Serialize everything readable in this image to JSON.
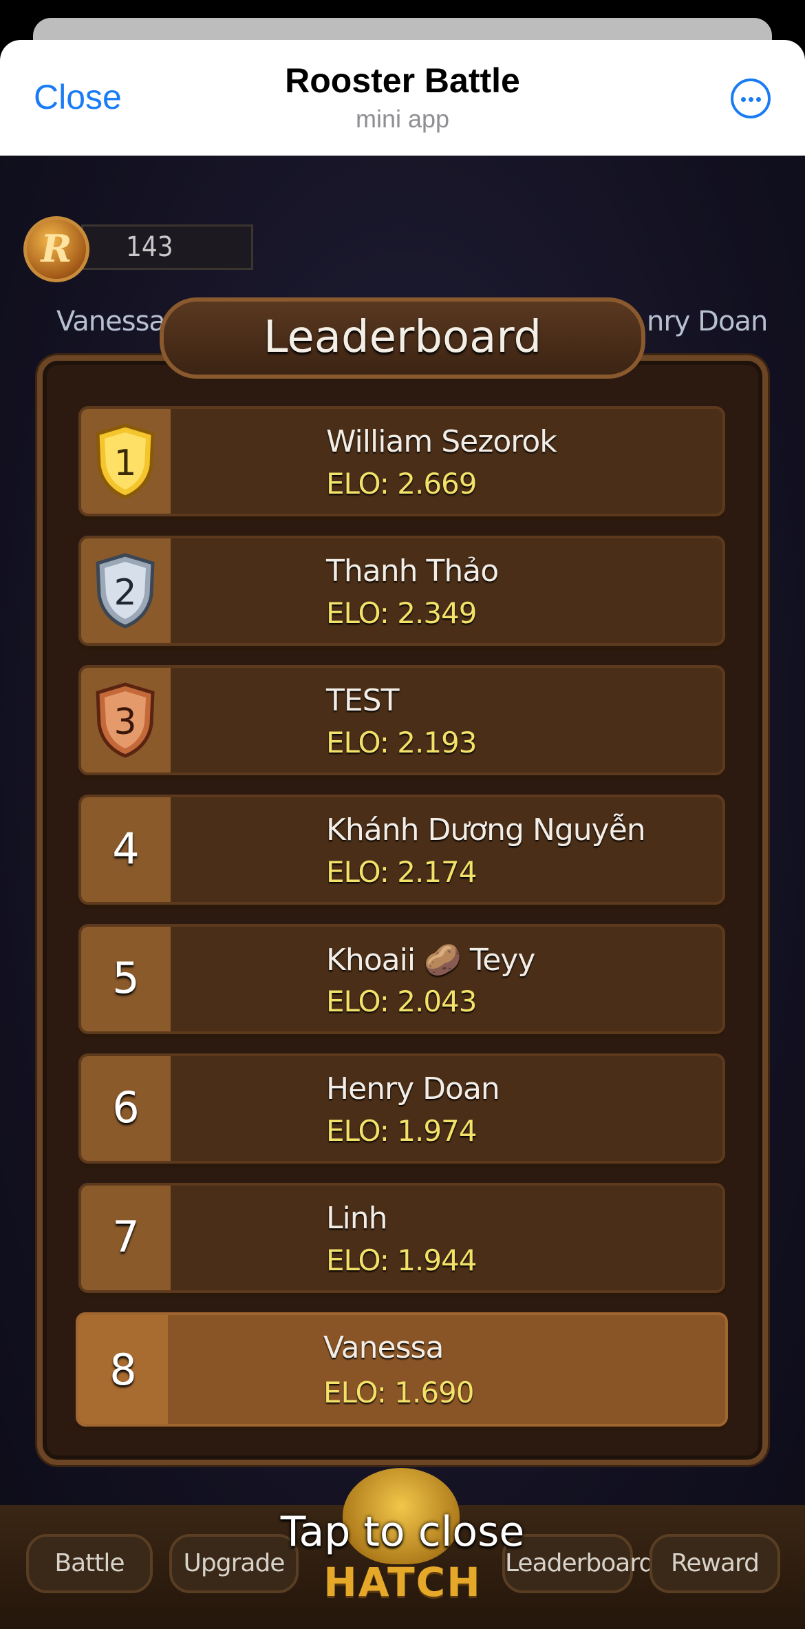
{
  "header": {
    "close_label": "Close",
    "title": "Rooster Battle",
    "subtitle": "mini app"
  },
  "game": {
    "coin_letter": "R",
    "coin_balance": "143",
    "left_player": "Vanessa",
    "right_player": "nry Doan"
  },
  "leaderboard": {
    "title": "Leaderboard",
    "rows": [
      {
        "rank": "1",
        "name": "William Sezorok",
        "elo": "ELO: 2.669",
        "badge": "gold-shield-icon"
      },
      {
        "rank": "2",
        "name": "Thanh Thảo",
        "elo": "ELO: 2.349",
        "badge": "silver-shield-icon"
      },
      {
        "rank": "3",
        "name": "TEST",
        "elo": "ELO: 2.193",
        "badge": "bronze-shield-icon"
      },
      {
        "rank": "4",
        "name": "Khánh Dương Nguyễn",
        "elo": "ELO: 2.174"
      },
      {
        "rank": "5",
        "name": "Khoaii 🥔 Teyy",
        "elo": "ELO: 2.043"
      },
      {
        "rank": "6",
        "name": "Henry Doan",
        "elo": "ELO: 1.974"
      },
      {
        "rank": "7",
        "name": "Linh",
        "elo": "ELO: 1.944"
      },
      {
        "rank": "8",
        "name": "Vanessa",
        "elo": "ELO: 1.690"
      }
    ]
  },
  "overlay": {
    "tap_to_close": "Tap to close"
  },
  "nav": {
    "battle": "Battle",
    "upgrade": "Upgrade",
    "hatch": "HATCH",
    "leaderboard": "Leaderboard",
    "reward": "Reward"
  },
  "colors": {
    "accent_blue": "#1a7cf5",
    "elo_yellow": "#f3e26a",
    "current_user_row": "#8a5526"
  }
}
